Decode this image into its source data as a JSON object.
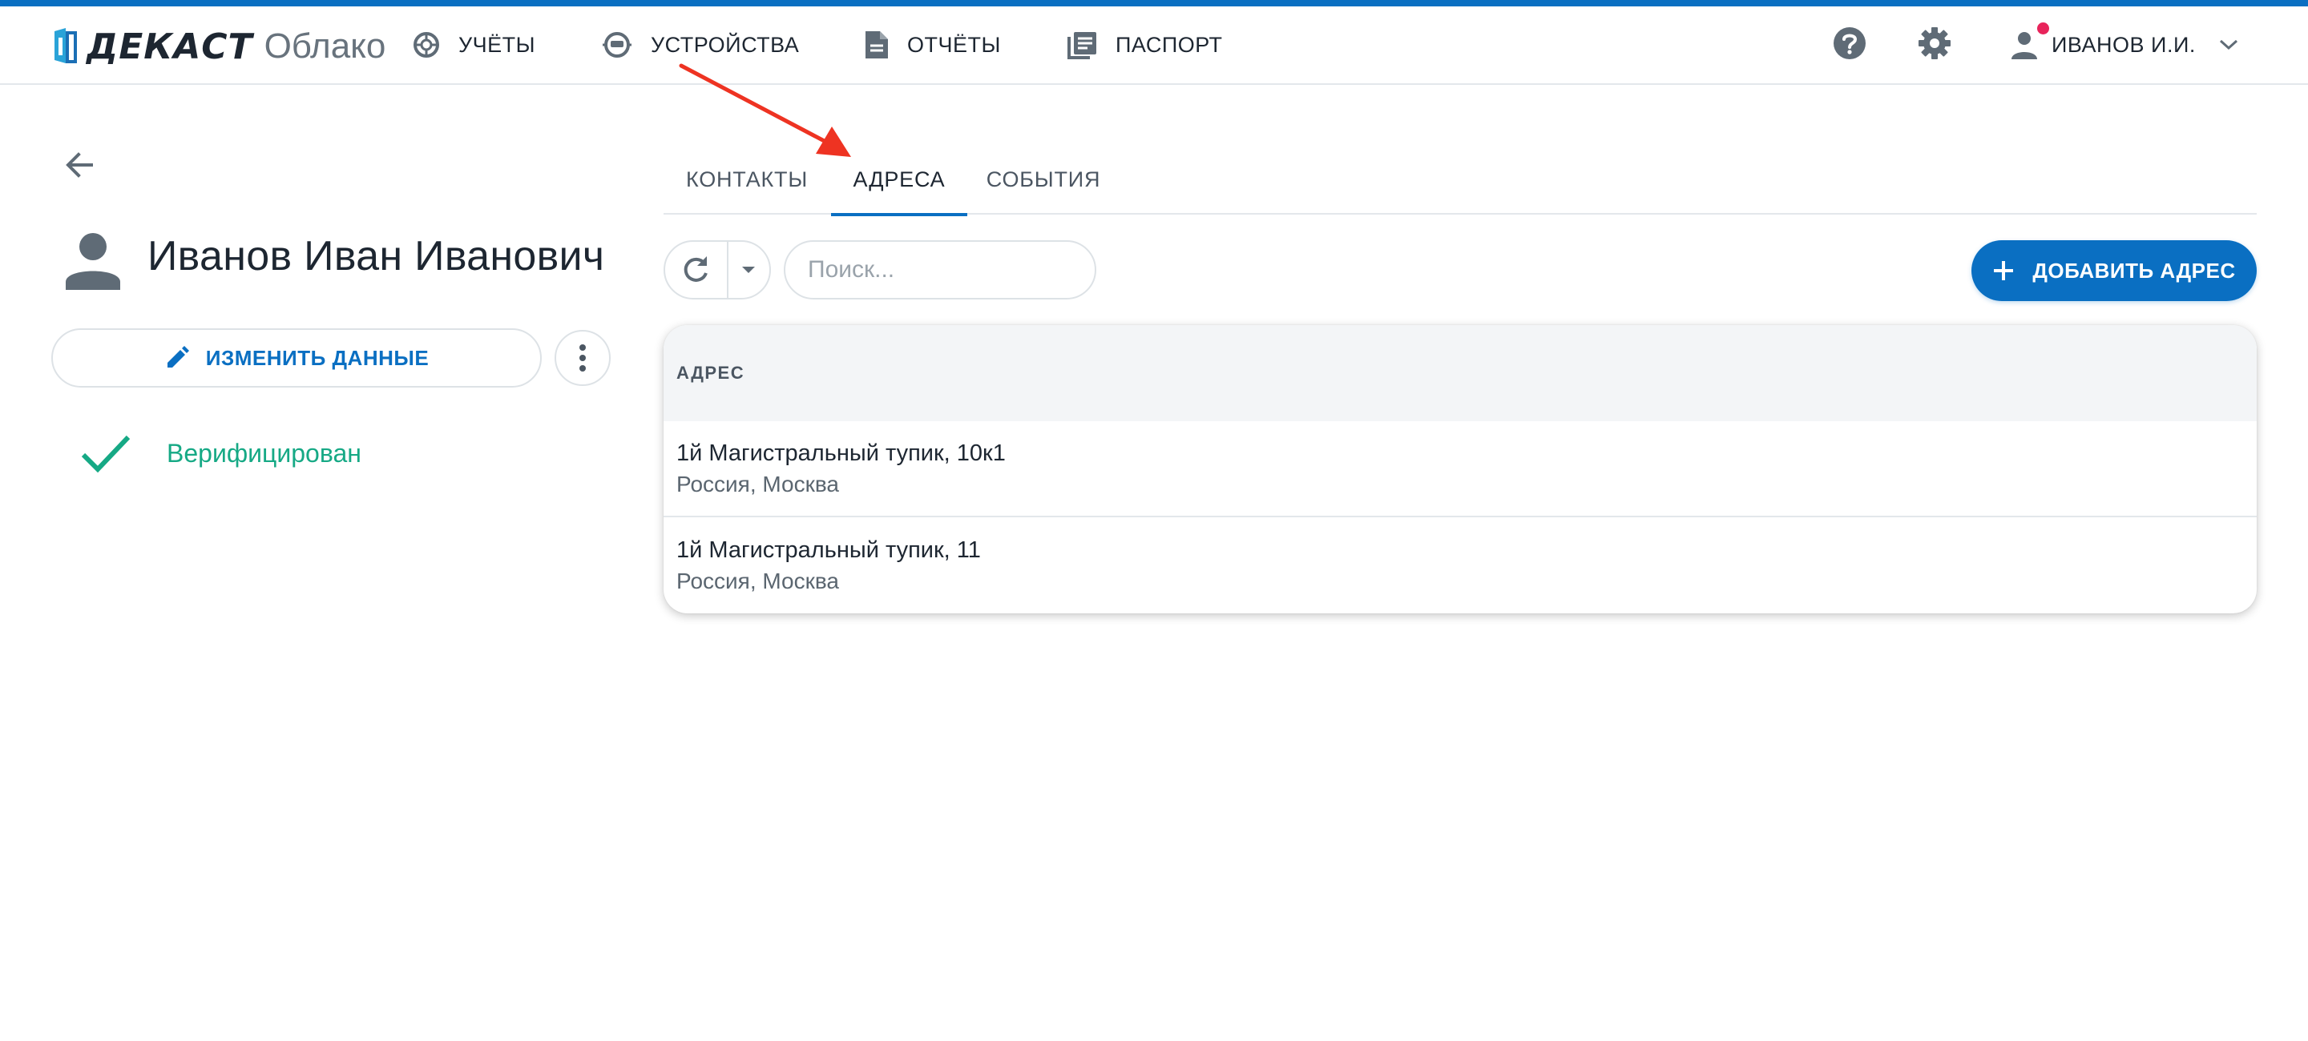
{
  "header": {
    "brand": "ДЕКАСТ",
    "brand_sub": "Облако",
    "nav": [
      {
        "label": "УЧЁТЫ",
        "icon": "meter-icon"
      },
      {
        "label": "УСТРОЙСТВА",
        "icon": "device-icon"
      },
      {
        "label": "ОТЧЁТЫ",
        "icon": "document-icon"
      },
      {
        "label": "ПАСПОРТ",
        "icon": "passport-icon"
      }
    ],
    "user_label": "ИВАНОВ И.И."
  },
  "profile": {
    "name": "Иванов Иван Иванович",
    "edit_label": "ИЗМЕНИТЬ ДАННЫЕ",
    "status": "Верифицирован"
  },
  "tabs": [
    {
      "label": "КОНТАКТЫ",
      "active": false
    },
    {
      "label": "АДРЕСА",
      "active": true
    },
    {
      "label": "СОБЫТИЯ",
      "active": false
    }
  ],
  "toolbar": {
    "search_placeholder": "Поиск...",
    "add_label": "ДОБАВИТЬ АДРЕС"
  },
  "table": {
    "header": "АДРЕС",
    "rows": [
      {
        "street": "1й Магистральный тупик, 10к1",
        "city": "Россия, Москва"
      },
      {
        "street": "1й Магистральный тупик, 11",
        "city": "Россия, Москва"
      }
    ]
  },
  "colors": {
    "accent": "#0a6fc2",
    "verified": "#16a985",
    "notification_dot": "#e8245b",
    "annotation_arrow": "#ee3322"
  }
}
